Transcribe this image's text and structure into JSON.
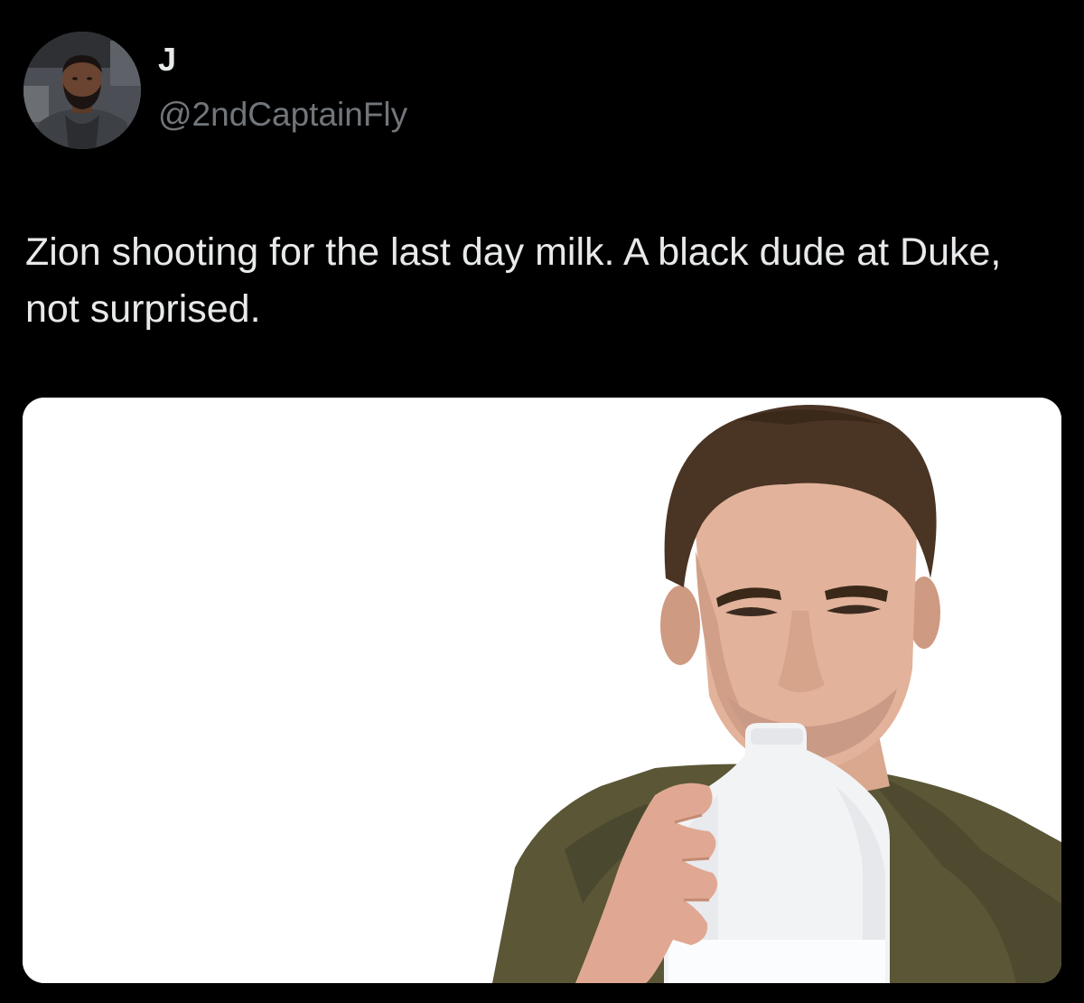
{
  "tweet": {
    "author": {
      "display_name": "J",
      "handle": "@2ndCaptainFly",
      "avatar_icon": "profile-photo"
    },
    "text": "Zion shooting for the last day milk. A black dude at Duke, not surprised.",
    "media": {
      "kind": "photo",
      "subject": "man-drinking-from-milk-jug"
    }
  },
  "colors": {
    "background": "#000000",
    "primary_text": "#e7e9ea",
    "secondary_text": "#71767b",
    "media_background": "#ffffff"
  }
}
